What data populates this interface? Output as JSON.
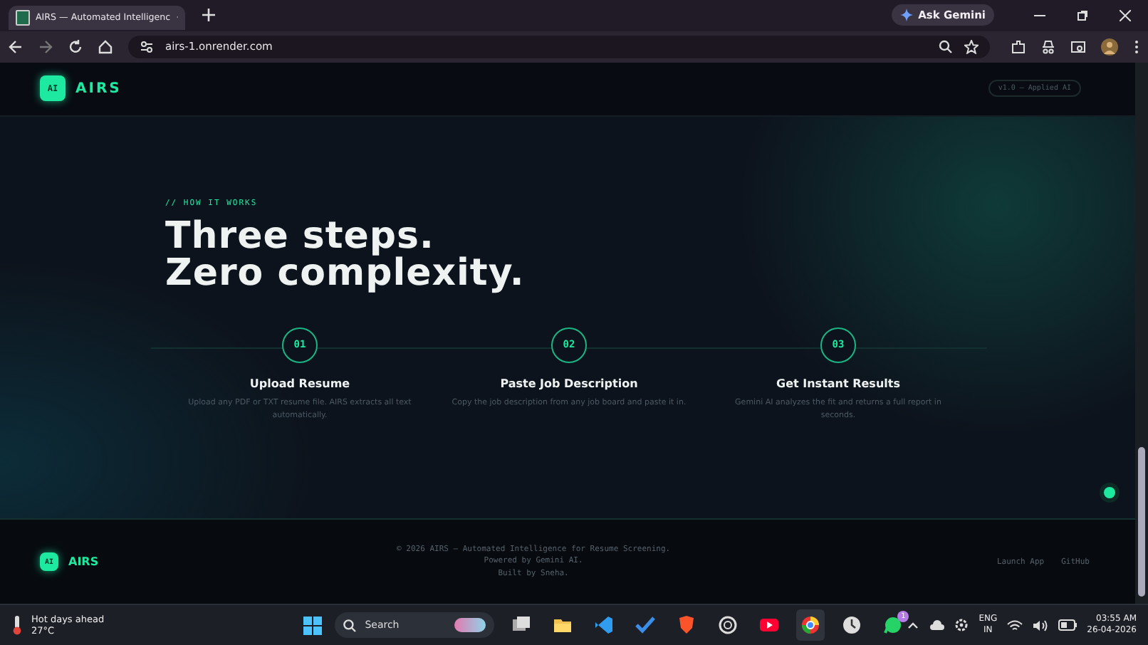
{
  "browser": {
    "tab_title": "AIRS — Automated Intelligenc",
    "ask_gemini": "Ask Gemini",
    "url": "airs-1.onrender.com"
  },
  "nav": {
    "logo_mark": "AI",
    "brand": "AIRS",
    "version": "v1.0 — Applied AI"
  },
  "hero": {
    "eyebrow": "// HOW IT WORKS",
    "headline": [
      "Three steps.",
      "Zero complexity."
    ]
  },
  "steps": [
    {
      "number": "01",
      "title": "Upload Resume",
      "text": "Upload any PDF or TXT resume file. AIRS extracts all text automatically."
    },
    {
      "number": "02",
      "title": "Paste Job Description",
      "text": "Copy the job description from any job board and paste it in."
    },
    {
      "number": "03",
      "title": "Get Instant Results",
      "text": "Gemini AI analyzes the fit and returns a full report in seconds."
    }
  ],
  "footer": {
    "logo_mark": "AI",
    "brand": "AIRS",
    "lines": [
      "© 2026 AIRS — Automated Intelligence for Resume Screening.",
      "Powered by Gemini AI.",
      "Built by Sneha."
    ],
    "links": [
      "Launch App",
      "GitHub"
    ]
  },
  "taskbar": {
    "weather": "Hot days ahead",
    "temperature": "27°C",
    "search": "Search",
    "badge": "1",
    "language": "ENG",
    "region": "IN",
    "time": "03:55 AM",
    "date": "26-04-2026"
  }
}
